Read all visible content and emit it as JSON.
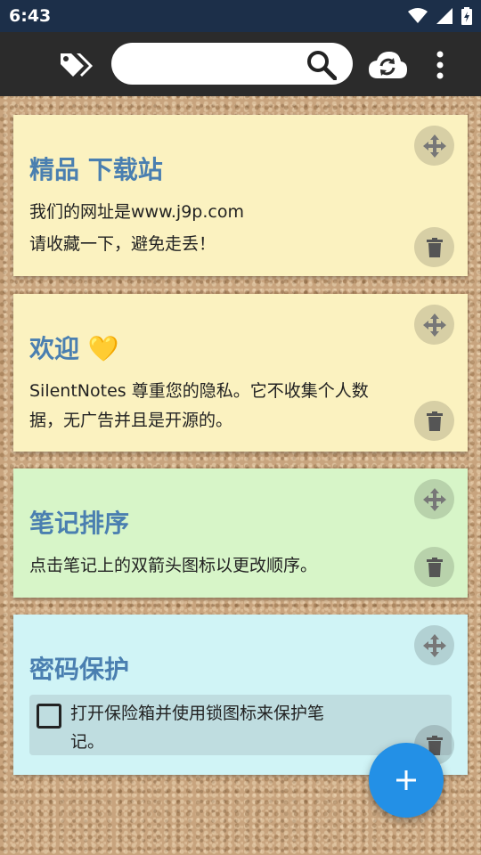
{
  "status_bar": {
    "time": "6:43"
  },
  "search": {
    "placeholder": ""
  },
  "colors": {
    "note_yellow": "#fbf2c0",
    "note_green": "#d7f5c8",
    "note_cyan": "#d0f4f6",
    "title_blue": "#4a7fb0",
    "fab_blue": "#2390e6",
    "app_bar": "#2b2b2b",
    "status_bar": "#1c2f49"
  },
  "icons": {
    "tag": "tag-icon",
    "search": "search-icon",
    "sync": "cloud-sync-icon",
    "menu": "more-vert-icon",
    "move": "move-icon",
    "delete": "delete-icon",
    "add": "plus-icon"
  },
  "notes": [
    {
      "title": "精品 下载站",
      "lines": [
        "我们的网址是www.j9p.com",
        "请收藏一下，避免走丢！"
      ]
    },
    {
      "title": "欢迎",
      "emoji": "💛",
      "lines": [
        "SilentNotes 尊重您的隐私。它不收集个人数",
        "据，无广告并且是开源的。"
      ]
    },
    {
      "title": "笔记排序",
      "lines": [
        "点击笔记上的双箭头图标以更改顺序。"
      ]
    },
    {
      "title": "密码保护",
      "checklist": {
        "lines": [
          "打开保险箱并使用锁图标来保护笔",
          "记。"
        ]
      }
    }
  ]
}
